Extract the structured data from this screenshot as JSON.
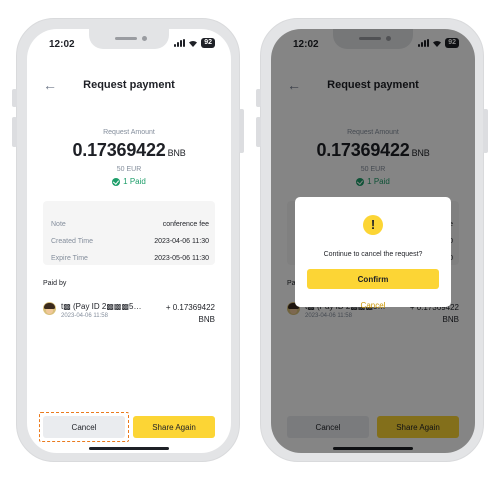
{
  "status": {
    "time": "12:02",
    "battery": "92"
  },
  "header": {
    "title": "Request payment"
  },
  "amount": {
    "label": "Request Amount",
    "value": "0.17369422",
    "currency": "BNB",
    "fiat": "50 EUR",
    "paid_count": "1 Paid"
  },
  "info": {
    "rows": [
      {
        "key": "Note",
        "value": "conference fee"
      },
      {
        "key": "Created Time",
        "value": "2023-04-06 11:30"
      },
      {
        "key": "Expire Time",
        "value": "2023-05-06 11:30"
      }
    ]
  },
  "paid_by": {
    "label": "Paid by",
    "payer_name": "t▩ (Pay ID 2▩▩▩5…",
    "payer_time": "2023-04-06 11:58",
    "payer_amount": "+ 0.17369422",
    "payer_currency": "BNB"
  },
  "buttons": {
    "cancel": "Cancel",
    "share": "Share Again"
  },
  "dialog": {
    "icon": "!",
    "message": "Continue to cancel the request?",
    "confirm": "Confirm",
    "cancel": "Cancel"
  },
  "colors": {
    "accent": "#fcd535",
    "success": "#1e9e6a",
    "highlight": "#ea7a1d"
  },
  "icons": {
    "back": "back-arrow-icon",
    "paid": "check-circle-icon",
    "warning": "exclamation-icon"
  }
}
